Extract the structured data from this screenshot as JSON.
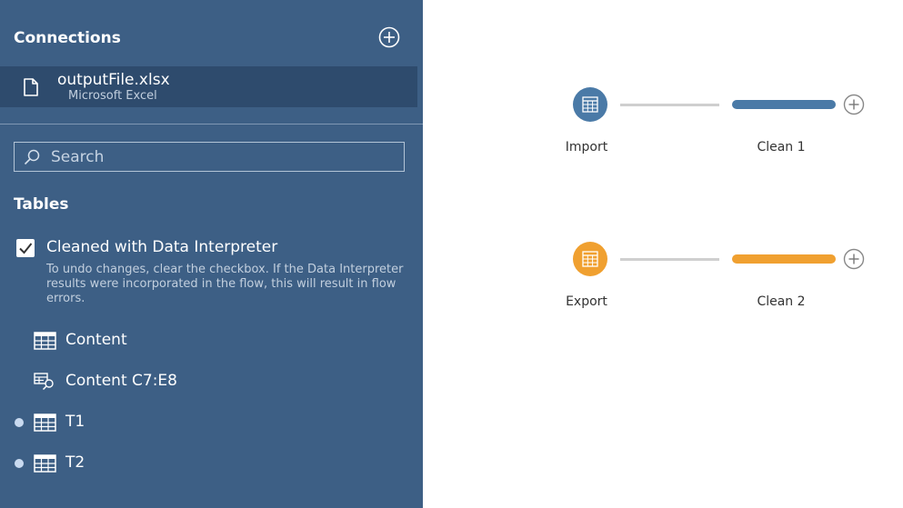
{
  "sidebar": {
    "connections_title": "Connections",
    "connection": {
      "name": "outputFile.xlsx",
      "type": "Microsoft Excel"
    },
    "search": {
      "placeholder": "Search"
    },
    "tables_title": "Tables",
    "interpreter": {
      "label": "Cleaned with Data Interpreter",
      "checked": true,
      "help": "To undo changes, clear the checkbox. If the Data Interpreter results were incorporated in the flow, this will result in flow errors."
    },
    "tables": [
      {
        "label": "Content",
        "icon": "table-icon",
        "in_flow": false
      },
      {
        "label": "Content C7:E8",
        "icon": "table-search-icon",
        "in_flow": false
      },
      {
        "label": "T1",
        "icon": "table-icon",
        "in_flow": true
      },
      {
        "label": "T2",
        "icon": "table-icon",
        "in_flow": true
      }
    ]
  },
  "flow": {
    "rows": [
      {
        "input_label": "Import",
        "clean_label": "Clean 1",
        "color": "#4a7aa7"
      },
      {
        "input_label": "Export",
        "clean_label": "Clean 2",
        "color": "#f0a030"
      }
    ]
  }
}
